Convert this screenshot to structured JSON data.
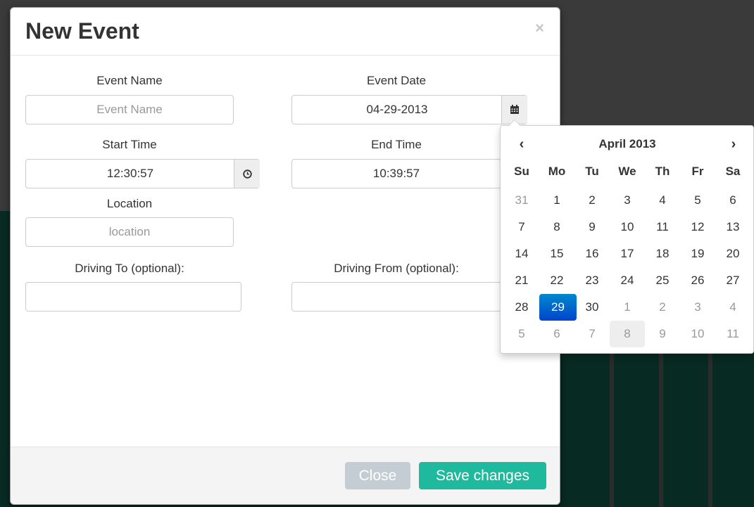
{
  "modal": {
    "title": "New Event",
    "close_symbol": "×"
  },
  "form": {
    "event_name": {
      "label": "Event Name",
      "placeholder": "Event Name",
      "value": ""
    },
    "event_date": {
      "label": "Event Date",
      "value": "04-29-2013",
      "addon_icon": "calendar-icon"
    },
    "start_time": {
      "label": "Start Time",
      "value": "12:30:57",
      "addon_icon": "clock-icon"
    },
    "end_time": {
      "label": "End Time",
      "value": "10:39:57"
    },
    "location": {
      "label": "Location",
      "placeholder": "location",
      "value": ""
    },
    "driving_to": {
      "label": "Driving To (optional):",
      "value": ""
    },
    "driving_from": {
      "label": "Driving From (optional):",
      "value": ""
    }
  },
  "footer": {
    "close_label": "Close",
    "save_label": "Save changes"
  },
  "datepicker": {
    "title": "April 2013",
    "prev_symbol": "‹",
    "next_symbol": "›",
    "weekdays": [
      "Su",
      "Mo",
      "Tu",
      "We",
      "Th",
      "Fr",
      "Sa"
    ],
    "days": [
      {
        "d": "31",
        "muted": true
      },
      {
        "d": "1"
      },
      {
        "d": "2"
      },
      {
        "d": "3"
      },
      {
        "d": "4"
      },
      {
        "d": "5"
      },
      {
        "d": "6"
      },
      {
        "d": "7"
      },
      {
        "d": "8"
      },
      {
        "d": "9"
      },
      {
        "d": "10"
      },
      {
        "d": "11"
      },
      {
        "d": "12"
      },
      {
        "d": "13"
      },
      {
        "d": "14"
      },
      {
        "d": "15"
      },
      {
        "d": "16"
      },
      {
        "d": "17"
      },
      {
        "d": "18"
      },
      {
        "d": "19"
      },
      {
        "d": "20"
      },
      {
        "d": "21"
      },
      {
        "d": "22"
      },
      {
        "d": "23"
      },
      {
        "d": "24"
      },
      {
        "d": "25"
      },
      {
        "d": "26"
      },
      {
        "d": "27"
      },
      {
        "d": "28"
      },
      {
        "d": "29",
        "active": true
      },
      {
        "d": "30"
      },
      {
        "d": "1",
        "muted": true
      },
      {
        "d": "2",
        "muted": true
      },
      {
        "d": "3",
        "muted": true
      },
      {
        "d": "4",
        "muted": true
      },
      {
        "d": "5",
        "muted": true
      },
      {
        "d": "6",
        "muted": true
      },
      {
        "d": "7",
        "muted": true
      },
      {
        "d": "8",
        "muted": true,
        "today": true
      },
      {
        "d": "9",
        "muted": true
      },
      {
        "d": "10",
        "muted": true
      },
      {
        "d": "11",
        "muted": true
      }
    ]
  },
  "colors": {
    "save_button": "#1fb99e",
    "close_button": "#c4cdd4",
    "active_day": "#0066cc"
  }
}
